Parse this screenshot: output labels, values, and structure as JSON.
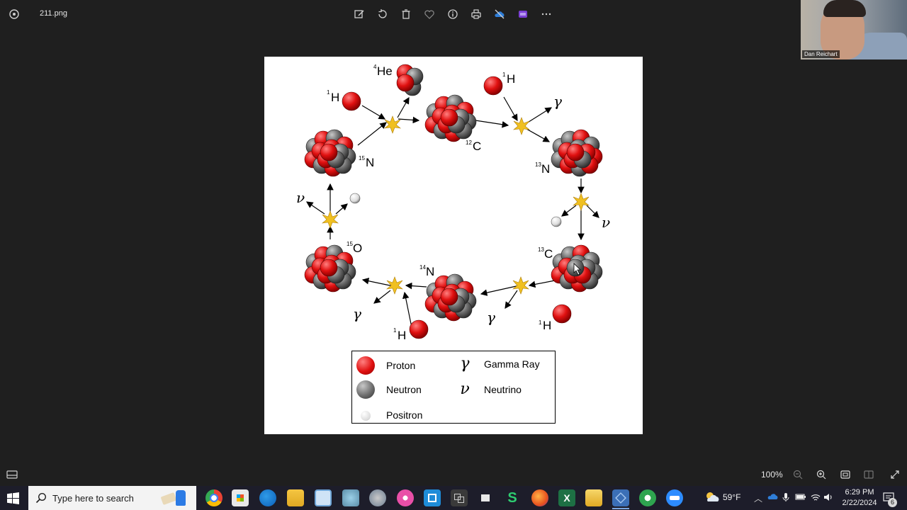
{
  "window": {
    "filename": "211.png",
    "zoom": "100%"
  },
  "toolbar": {
    "buttons": [
      "edit-icon",
      "rotate-icon",
      "delete-icon",
      "favorite-icon",
      "info-icon",
      "print-icon",
      "onedrive-icon",
      "clipchamp-icon",
      "more-icon"
    ]
  },
  "webcam": {
    "name": "Dan Reichart"
  },
  "diagram": {
    "labels": {
      "he4_mass": "4",
      "he4_sym": "He",
      "h1a_mass": "1",
      "h1a_sym": "H",
      "h1b_mass": "1",
      "h1b_sym": "H",
      "h1c_mass": "1",
      "h1c_sym": "H",
      "h1d_mass": "1",
      "h1d_sym": "H",
      "c12_mass": "12",
      "c12_sym": "C",
      "n15_mass": "15",
      "n15_sym": "N",
      "n13_mass": "13",
      "n13_sym": "N",
      "o15_mass": "15",
      "o15_sym": "O",
      "c13_mass": "13",
      "c13_sym": "C",
      "n14_mass": "14",
      "n14_sym": "N",
      "gamma": "γ",
      "nu": "ν"
    },
    "legend": {
      "proton": "Proton",
      "neutron": "Neutron",
      "positron": "Positron",
      "gamma_symbol": "γ",
      "gamma_label": "Gamma Ray",
      "nu_symbol": "ν",
      "nu_label": "Neutrino"
    },
    "colors": {
      "proton": "#e01010",
      "neutron": "#707070",
      "positron": "#e8e8e8",
      "flash": "#f0c020"
    }
  },
  "taskbar": {
    "search_placeholder": "Type here to search",
    "weather": "59°F",
    "time": "6:29 PM",
    "date": "2/22/2024",
    "notification_count": "6"
  }
}
